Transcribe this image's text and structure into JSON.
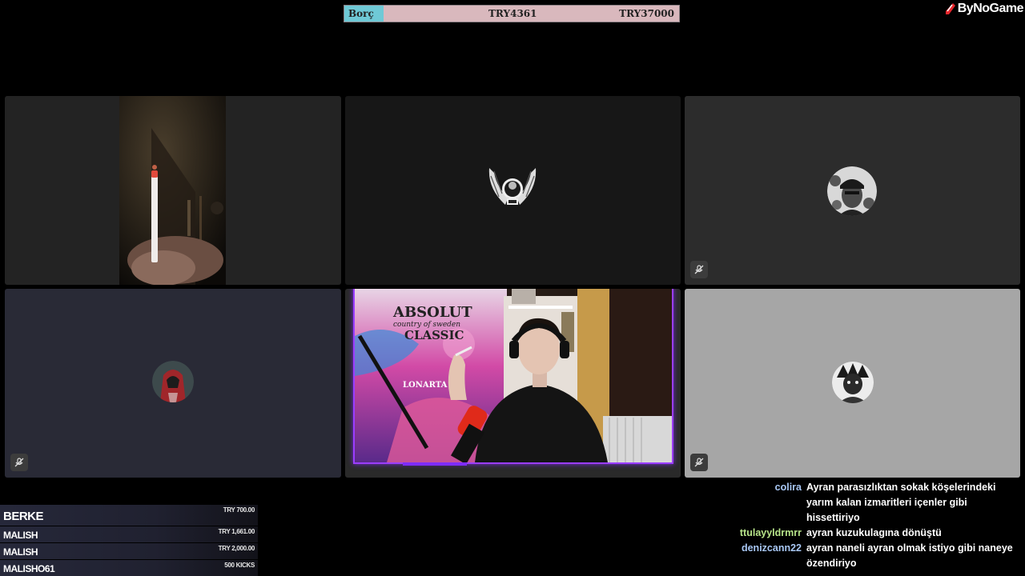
{
  "goal": {
    "label": "Borç",
    "current": "TRY4361",
    "target": "TRY37000",
    "progress_fraction": 0.118,
    "fill_color": "#6fc9d6",
    "bar_color": "#d9b8bd"
  },
  "brand": {
    "text": "ByNoGame",
    "icon": "bynogame-logo-icon"
  },
  "tiles": [
    {
      "id": "participant-1",
      "bg": "#232323",
      "content": "camera-cigarette"
    },
    {
      "id": "participant-2",
      "bg": "#171717",
      "avatar": "winged-skull-avatar"
    },
    {
      "id": "participant-3",
      "bg": "#2c2c2c",
      "avatar": "capped-man-avatar",
      "muted": true
    },
    {
      "id": "participant-4",
      "bg": "#292a36",
      "avatar": "hooded-assassin-avatar",
      "muted": true
    },
    {
      "id": "participant-5",
      "bg": "#2a2a2a",
      "content": "streamer-camera",
      "accent": "#9b3dff"
    },
    {
      "id": "participant-6",
      "bg": "#a6a6a6",
      "avatar": "anime-character-avatar",
      "muted": true
    }
  ],
  "donations": [
    {
      "name": "BERKE",
      "amount": "TRY 700.00"
    },
    {
      "name": "MALISH",
      "amount": "TRY 1,661.00"
    },
    {
      "name": "MALISH",
      "amount": "TRY 2,000.00"
    },
    {
      "name": "MALISHO61",
      "amount": "500 KICKS"
    }
  ],
  "chat": [
    {
      "user": "colira",
      "color": "#a9c8f5",
      "text": "Ayran parasızlıktan sokak köşelerindeki yarım kalan izmaritleri içenler gibi hissettiriyo"
    },
    {
      "user": "ttulayyldrmrr",
      "color": "#b7e48a",
      "text": "ayran kuzukulagına dönüştü"
    },
    {
      "user": "denizcann22",
      "color": "#a9c8f5",
      "text": "ayran naneli ayran olmak istiyo gibi naneye özendiriyo"
    }
  ],
  "poster_text": {
    "line1": "ABSOLUT",
    "line2": "country of sweden",
    "line3": "CLASSIC",
    "line4": "LONARTA"
  }
}
